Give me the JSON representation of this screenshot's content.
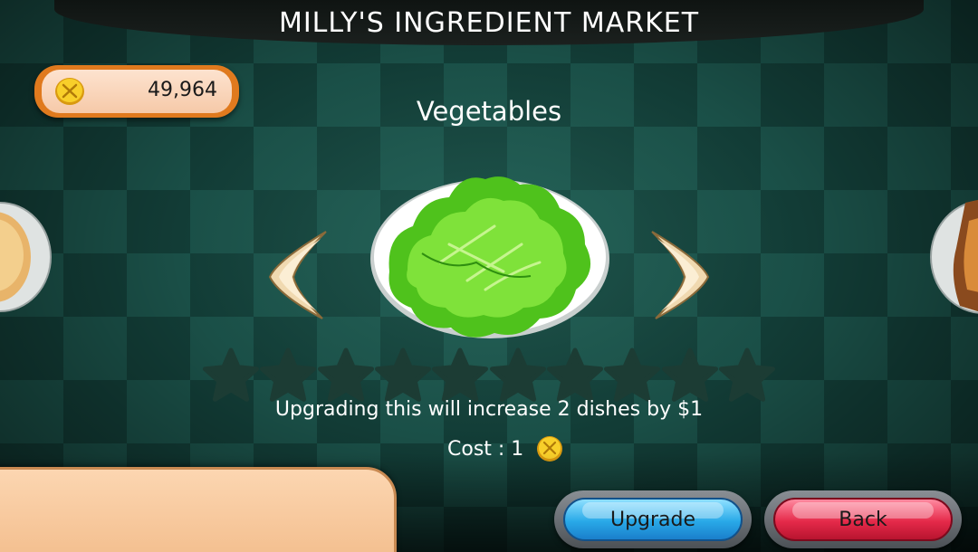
{
  "header": {
    "title": "MILLY'S INGREDIENT MARKET"
  },
  "wallet": {
    "coins": "49,964",
    "icon": "coin-icon"
  },
  "market": {
    "category": "Vegetables",
    "item_icon": "lettuce-plate-icon",
    "prev_icon": "chevron-left-icon",
    "next_icon": "chevron-right-icon",
    "stars_total": 10,
    "stars_filled": 0,
    "description": "Upgrading this will increase 2 dishes by $1",
    "cost_label": "Cost : 1",
    "cost_icon": "coin-icon"
  },
  "buttons": {
    "upgrade": "Upgrade",
    "back": "Back"
  },
  "colors": {
    "board_dark": "#123c36",
    "board_light": "#1a4f47",
    "wallet_border": "#e07a1e",
    "upgrade_blue": "#29a9e8",
    "back_red": "#e52a4a",
    "coin_gold": "#f2c21a"
  }
}
